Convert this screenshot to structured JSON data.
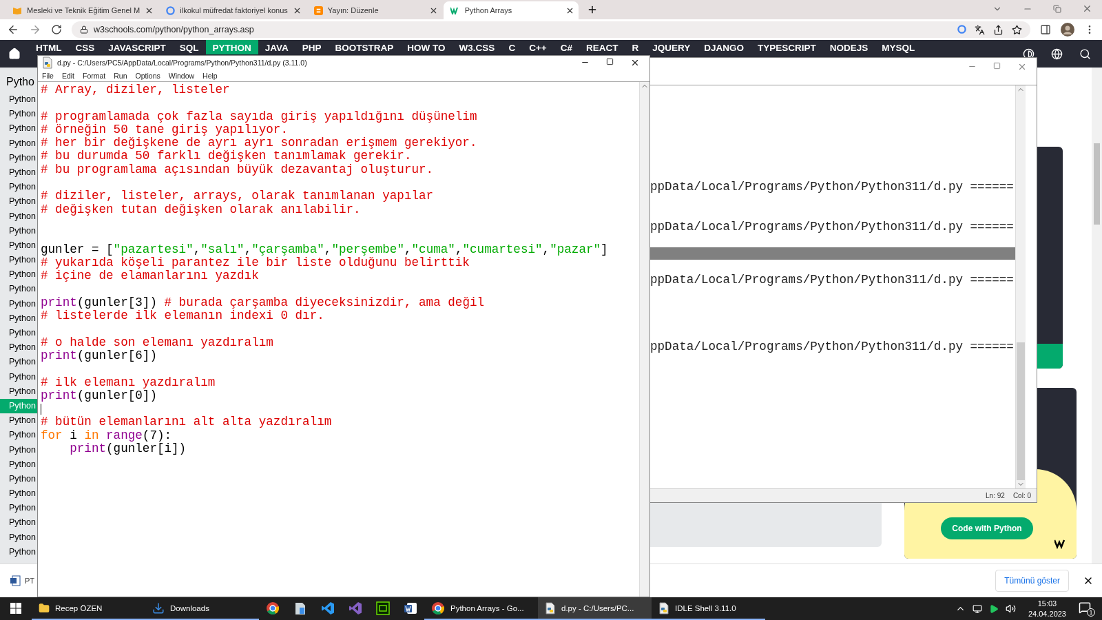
{
  "browser": {
    "tabs": [
      {
        "title": "Mesleki ve Teknik Eğitim Genel M",
        "selected": false
      },
      {
        "title": "ilkokul müfredat faktoriyel konus",
        "selected": false
      },
      {
        "title": "Yayın: Düzenle",
        "selected": false
      },
      {
        "title": "Python Arrays",
        "selected": true
      }
    ],
    "url": "w3schools.com/python/python_arrays.asp"
  },
  "site_nav": {
    "items": [
      {
        "label": "HTML",
        "selected": false
      },
      {
        "label": "CSS",
        "selected": false
      },
      {
        "label": "JAVASCRIPT",
        "selected": false
      },
      {
        "label": "SQL",
        "selected": false
      },
      {
        "label": "PYTHON",
        "selected": true
      },
      {
        "label": "JAVA",
        "selected": false
      },
      {
        "label": "PHP",
        "selected": false
      },
      {
        "label": "BOOTSTRAP",
        "selected": false
      },
      {
        "label": "HOW TO",
        "selected": false
      },
      {
        "label": "W3.CSS",
        "selected": false
      },
      {
        "label": "C",
        "selected": false
      },
      {
        "label": "C++",
        "selected": false
      },
      {
        "label": "C#",
        "selected": false
      },
      {
        "label": "REACT",
        "selected": false
      },
      {
        "label": "R",
        "selected": false
      },
      {
        "label": "JQUERY",
        "selected": false
      },
      {
        "label": "DJANGO",
        "selected": false
      },
      {
        "label": "TYPESCRIPT",
        "selected": false
      },
      {
        "label": "NODEJS",
        "selected": false
      },
      {
        "label": "MYSQL",
        "selected": false
      }
    ]
  },
  "sidebar": {
    "heading": "Pytho",
    "items": [
      {
        "label": "Python",
        "selected": false
      },
      {
        "label": "Python",
        "selected": false
      },
      {
        "label": "Python",
        "selected": false
      },
      {
        "label": "Python",
        "selected": false
      },
      {
        "label": "Python",
        "selected": false
      },
      {
        "label": "Python",
        "selected": false
      },
      {
        "label": "Python",
        "selected": false
      },
      {
        "label": "Python",
        "selected": false
      },
      {
        "label": "Python",
        "selected": false
      },
      {
        "label": "Python",
        "selected": false
      },
      {
        "label": "Python",
        "selected": false
      },
      {
        "label": "Python",
        "selected": false
      },
      {
        "label": "Python",
        "selected": false
      },
      {
        "label": "Python",
        "selected": false
      },
      {
        "label": "Python",
        "selected": false
      },
      {
        "label": "Python",
        "selected": false
      },
      {
        "label": "Python",
        "selected": false
      },
      {
        "label": "Python",
        "selected": false
      },
      {
        "label": "Python",
        "selected": false
      },
      {
        "label": "Python",
        "selected": false
      },
      {
        "label": "Python",
        "selected": false
      },
      {
        "label": "Python",
        "selected": true
      },
      {
        "label": "Python",
        "selected": false
      },
      {
        "label": "Python",
        "selected": false
      },
      {
        "label": "Python",
        "selected": false
      },
      {
        "label": "Python",
        "selected": false
      },
      {
        "label": "Python",
        "selected": false
      },
      {
        "label": "Python",
        "selected": false
      },
      {
        "label": "Python",
        "selected": false
      },
      {
        "label": "Python",
        "selected": false
      },
      {
        "label": "Python",
        "selected": false
      },
      {
        "label": "Python",
        "selected": false
      }
    ]
  },
  "promo": {
    "button": "Code with Python"
  },
  "download_bar": {
    "file": "PT",
    "show_all": "Tümünü göster"
  },
  "editor": {
    "title": "d.py - C:/Users/PC5/AppData/Local/Programs/Python/Python311/d.py (3.11.0)",
    "menu": [
      "File",
      "Edit",
      "Format",
      "Run",
      "Options",
      "Window",
      "Help"
    ],
    "lines": [
      {
        "kind": "code",
        "tokens": [
          {
            "kind": "comment",
            "text": "# Array, diziler, listeler"
          }
        ]
      },
      {
        "kind": "blank"
      },
      {
        "kind": "code",
        "tokens": [
          {
            "kind": "comment",
            "text": "# programlamada çok fazla sayıda giriş yapıldığını düşünelim"
          }
        ]
      },
      {
        "kind": "code",
        "tokens": [
          {
            "kind": "comment",
            "text": "# örneğin 50 tane giriş yapılıyor."
          }
        ]
      },
      {
        "kind": "code",
        "tokens": [
          {
            "kind": "comment",
            "text": "# her bir değişkene de ayrı ayrı sonradan erişmem gerekiyor."
          }
        ]
      },
      {
        "kind": "code",
        "tokens": [
          {
            "kind": "comment",
            "text": "# bu durumda 50 farklı değişken tanımlamak gerekir."
          }
        ]
      },
      {
        "kind": "code",
        "tokens": [
          {
            "kind": "comment",
            "text": "# bu programlama açısından büyük dezavantaj oluşturur."
          }
        ]
      },
      {
        "kind": "blank"
      },
      {
        "kind": "code",
        "tokens": [
          {
            "kind": "comment",
            "text": "# diziler, listeler, arrays, olarak tanımlanan yapılar"
          }
        ]
      },
      {
        "kind": "code",
        "tokens": [
          {
            "kind": "comment",
            "text": "# değişken tutan değişken olarak anılabilir."
          }
        ]
      },
      {
        "kind": "blank"
      },
      {
        "kind": "blank"
      },
      {
        "kind": "code",
        "tokens": [
          {
            "kind": "plain",
            "text": "gunler = ["
          },
          {
            "kind": "string",
            "text": "\"pazartesi\""
          },
          {
            "kind": "plain",
            "text": ","
          },
          {
            "kind": "string",
            "text": "\"salı\""
          },
          {
            "kind": "plain",
            "text": ","
          },
          {
            "kind": "string",
            "text": "\"çarşamba\""
          },
          {
            "kind": "plain",
            "text": ","
          },
          {
            "kind": "string",
            "text": "\"perşembe\""
          },
          {
            "kind": "plain",
            "text": ","
          },
          {
            "kind": "string",
            "text": "\"cuma\""
          },
          {
            "kind": "plain",
            "text": ","
          },
          {
            "kind": "string",
            "text": "\"cumartesi\""
          },
          {
            "kind": "plain",
            "text": ","
          },
          {
            "kind": "string",
            "text": "\"pazar\""
          },
          {
            "kind": "plain",
            "text": "]"
          }
        ]
      },
      {
        "kind": "code",
        "tokens": [
          {
            "kind": "comment",
            "text": "# yukarıda köşeli parantez ile bir liste olduğunu belirttik"
          }
        ]
      },
      {
        "kind": "code",
        "tokens": [
          {
            "kind": "comment",
            "text": "# içine de elamanlarını yazdık"
          }
        ]
      },
      {
        "kind": "blank"
      },
      {
        "kind": "code",
        "tokens": [
          {
            "kind": "builtin",
            "text": "print"
          },
          {
            "kind": "plain",
            "text": "(gunler[3]) "
          },
          {
            "kind": "comment",
            "text": "# burada çarşamba diyeceksinizdir, ama değil"
          }
        ]
      },
      {
        "kind": "code",
        "tokens": [
          {
            "kind": "comment",
            "text": "# listelerde ilk elemanın indexi 0 dır."
          }
        ]
      },
      {
        "kind": "blank"
      },
      {
        "kind": "code",
        "tokens": [
          {
            "kind": "comment",
            "text": "# o halde son elemanı yazdıralım"
          }
        ]
      },
      {
        "kind": "code",
        "tokens": [
          {
            "kind": "builtin",
            "text": "print"
          },
          {
            "kind": "plain",
            "text": "(gunler[6])"
          }
        ]
      },
      {
        "kind": "blank"
      },
      {
        "kind": "code",
        "tokens": [
          {
            "kind": "comment",
            "text": "# ilk elemanı yazdıralım"
          }
        ]
      },
      {
        "kind": "code",
        "tokens": [
          {
            "kind": "builtin",
            "text": "print"
          },
          {
            "kind": "plain",
            "text": "(gunler[0])"
          }
        ]
      },
      {
        "kind": "cursor"
      },
      {
        "kind": "code",
        "tokens": [
          {
            "kind": "comment",
            "text": "# bütün elemanlarını alt alta yazdıralım"
          }
        ]
      },
      {
        "kind": "code",
        "tokens": [
          {
            "kind": "keyword",
            "text": "for"
          },
          {
            "kind": "plain",
            "text": " i "
          },
          {
            "kind": "keyword",
            "text": "in"
          },
          {
            "kind": "builtin",
            "text": " range"
          },
          {
            "kind": "plain",
            "text": "(7):"
          }
        ]
      },
      {
        "kind": "code",
        "tokens": [
          {
            "kind": "builtin",
            "text": "    print"
          },
          {
            "kind": "plain",
            "text": "(gunler[i])"
          }
        ]
      }
    ]
  },
  "shell": {
    "lines": [
      {
        "kind": "blank"
      },
      {
        "kind": "blank"
      },
      {
        "kind": "blank"
      },
      {
        "kind": "blank"
      },
      {
        "kind": "blank"
      },
      {
        "kind": "blank"
      },
      {
        "kind": "blank"
      },
      {
        "kind": "output",
        "text": "ppData/Local/Programs/Python/Python311/d.py ======"
      },
      {
        "kind": "blank"
      },
      {
        "kind": "blank"
      },
      {
        "kind": "output",
        "text": "ppData/Local/Programs/Python/Python311/d.py ======"
      },
      {
        "kind": "blank"
      },
      {
        "kind": "highlight"
      },
      {
        "kind": "blank"
      },
      {
        "kind": "output",
        "text": "ppData/Local/Programs/Python/Python311/d.py ======"
      },
      {
        "kind": "blank"
      },
      {
        "kind": "blank"
      },
      {
        "kind": "blank"
      },
      {
        "kind": "blank"
      },
      {
        "kind": "output",
        "text": "ppData/Local/Programs/Python/Python311/d.py ======"
      }
    ],
    "status": [
      "Ln: 92",
      "Col: 0"
    ]
  },
  "taskbar": {
    "items": [
      {
        "kind": "folder",
        "label": "Recep ÖZEN",
        "active": false
      },
      {
        "kind": "download",
        "label": "Downloads",
        "active": false
      },
      {
        "kind": "chrome",
        "active": false
      },
      {
        "kind": "sublime",
        "active": false
      },
      {
        "kind": "vscode",
        "active": false
      },
      {
        "kind": "visualstudio",
        "active": false
      },
      {
        "kind": "dreamweaver",
        "active": false
      },
      {
        "kind": "word",
        "active": false
      },
      {
        "kind": "chrome",
        "label": "Python Arrays - Go...",
        "active": false
      },
      {
        "kind": "python",
        "label": "d.py - C:/Users/PC...",
        "active": true
      },
      {
        "kind": "python",
        "label": "IDLE Shell 3.11.0",
        "active": false
      }
    ],
    "time": "15:03",
    "date": "24.04.2023",
    "notifications": "1"
  }
}
